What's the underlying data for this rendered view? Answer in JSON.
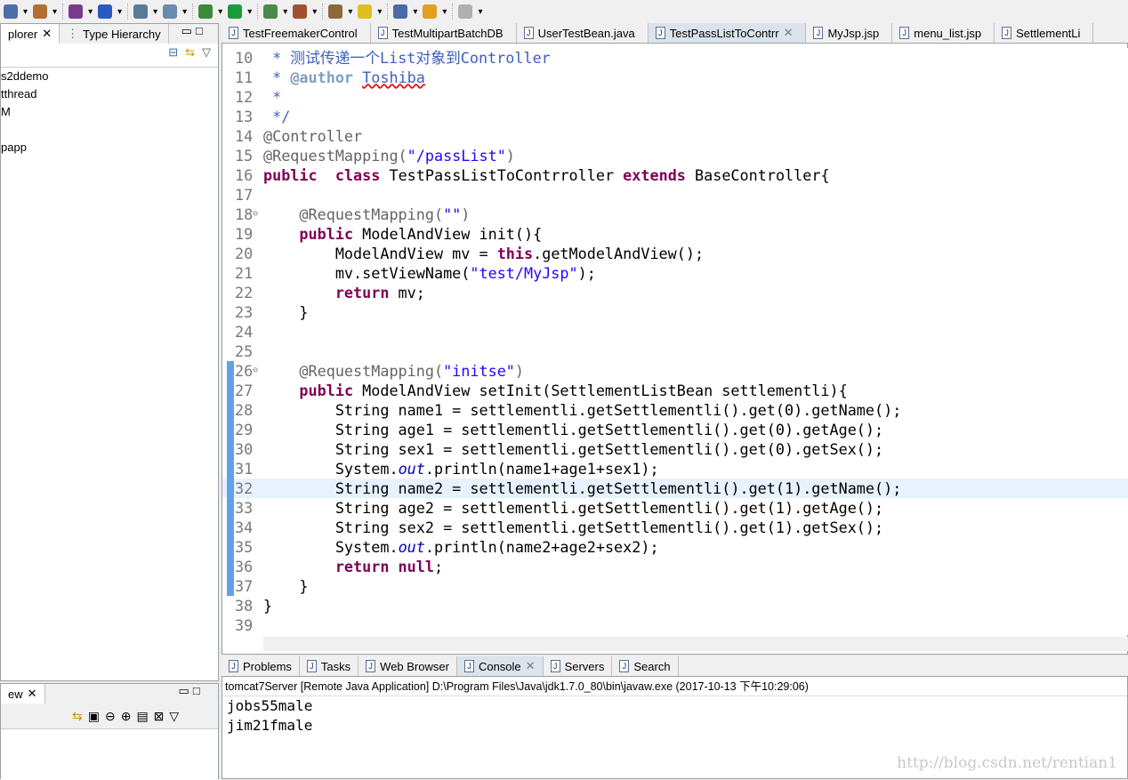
{
  "toolbar": {
    "icons": [
      "print-icon",
      "new-project-icon",
      "package-icon",
      "class-icon",
      "jdk-icon",
      "search-icon",
      "debug-icon",
      "run-icon",
      "coverage-icon",
      "tools-icon",
      "open-type-icon",
      "highlight-icon",
      "next-annotation-icon",
      "back-icon",
      "forward-icon"
    ]
  },
  "left_panel": {
    "tabs": [
      {
        "label": "plorer"
      },
      {
        "label": "Type Hierarchy"
      }
    ],
    "items": [
      "s2ddemo",
      "tthread",
      "M",
      "",
      "papp"
    ]
  },
  "left_bottom": {
    "tab": "ew"
  },
  "editor": {
    "tabs": [
      {
        "label": "TestFreemakerControl"
      },
      {
        "label": "TestMultipartBatchDB"
      },
      {
        "label": "UserTestBean.java"
      },
      {
        "label": "TestPassListToContrr",
        "active": true
      },
      {
        "label": "MyJsp.jsp"
      },
      {
        "label": "menu_list.jsp"
      },
      {
        "label": "SettlementLi"
      }
    ],
    "current_line": 32,
    "lines": [
      {
        "n": "10",
        "t": [
          [
            "cm",
            " * 测试传递一个List对象到Controller"
          ]
        ]
      },
      {
        "n": "11",
        "t": [
          [
            "cm",
            " * "
          ],
          [
            "tag",
            "@author"
          ],
          [
            "cm",
            " "
          ],
          [
            "auth",
            "Toshiba"
          ]
        ]
      },
      {
        "n": "12",
        "t": [
          [
            "cm",
            " *"
          ]
        ]
      },
      {
        "n": "13",
        "t": [
          [
            "cm",
            " */"
          ]
        ]
      },
      {
        "n": "14",
        "t": [
          [
            "an",
            "@Controller"
          ]
        ]
      },
      {
        "n": "15",
        "t": [
          [
            "an",
            "@RequestMapping("
          ],
          [
            "str",
            "\"/passList\""
          ],
          [
            "an",
            ")"
          ]
        ]
      },
      {
        "n": "16",
        "t": [
          [
            "kw",
            "public"
          ],
          [
            "",
            "  "
          ],
          [
            "kw",
            "class"
          ],
          [
            "",
            " TestPassListToContrroller "
          ],
          [
            "kw",
            "extends"
          ],
          [
            "",
            " BaseController{"
          ]
        ]
      },
      {
        "n": "17",
        "t": []
      },
      {
        "n": "18",
        "t": [
          [
            "an",
            "    @RequestMapping("
          ],
          [
            "str",
            "\"\""
          ],
          [
            "an",
            ")"
          ]
        ]
      },
      {
        "n": "19",
        "t": [
          [
            "",
            "    "
          ],
          [
            "kw",
            "public"
          ],
          [
            "",
            " ModelAndView init(){"
          ]
        ]
      },
      {
        "n": "20",
        "t": [
          [
            "",
            "        ModelAndView mv = "
          ],
          [
            "kw",
            "this"
          ],
          [
            "",
            ".getModelAndView();"
          ]
        ]
      },
      {
        "n": "21",
        "t": [
          [
            "",
            "        mv.setViewName("
          ],
          [
            "str",
            "\"test/MyJsp\""
          ],
          [
            "",
            ");"
          ]
        ]
      },
      {
        "n": "22",
        "t": [
          [
            "",
            "        "
          ],
          [
            "kw",
            "return"
          ],
          [
            "",
            " mv;"
          ]
        ]
      },
      {
        "n": "23",
        "t": [
          [
            "",
            "    }"
          ]
        ]
      },
      {
        "n": "24",
        "t": []
      },
      {
        "n": "25",
        "t": []
      },
      {
        "n": "26",
        "t": [
          [
            "an",
            "    @RequestMapping("
          ],
          [
            "str",
            "\"initse\""
          ],
          [
            "an",
            ")"
          ]
        ]
      },
      {
        "n": "27",
        "t": [
          [
            "",
            "    "
          ],
          [
            "kw",
            "public"
          ],
          [
            "",
            " ModelAndView setInit(SettlementListBean settlementli){"
          ]
        ]
      },
      {
        "n": "28",
        "t": [
          [
            "",
            "        String name1 = settlementli.getSettlementli().get(0).getName();"
          ]
        ]
      },
      {
        "n": "29",
        "t": [
          [
            "",
            "        String age1 = settlementli.getSettlementli().get(0).getAge();"
          ]
        ]
      },
      {
        "n": "30",
        "t": [
          [
            "",
            "        String sex1 = settlementli.getSettlementli().get(0).getSex();"
          ]
        ]
      },
      {
        "n": "31",
        "t": [
          [
            "",
            "        System."
          ],
          [
            "fld",
            "out"
          ],
          [
            "",
            ".println(name1+age1+sex1);"
          ]
        ]
      },
      {
        "n": "32",
        "t": [
          [
            "",
            "        String name2 = settlementli.getSettlementli().get(1).getName();"
          ]
        ]
      },
      {
        "n": "33",
        "t": [
          [
            "",
            "        String age2 = settlementli.getSettlementli().get(1).getAge();"
          ]
        ]
      },
      {
        "n": "34",
        "t": [
          [
            "",
            "        String sex2 = settlementli.getSettlementli().get(1).getSex();"
          ]
        ]
      },
      {
        "n": "35",
        "t": [
          [
            "",
            "        System."
          ],
          [
            "fld",
            "out"
          ],
          [
            "",
            ".println(name2+age2+sex2);"
          ]
        ]
      },
      {
        "n": "36",
        "t": [
          [
            "",
            "        "
          ],
          [
            "kw",
            "return"
          ],
          [
            "",
            ""
          ],
          [
            "kw",
            " null"
          ],
          [
            "",
            ";"
          ]
        ]
      },
      {
        "n": "37",
        "t": [
          [
            "",
            "    }"
          ]
        ]
      },
      {
        "n": "38",
        "t": [
          [
            "",
            "}"
          ]
        ]
      },
      {
        "n": "39",
        "t": []
      }
    ]
  },
  "bottom": {
    "tabs": [
      {
        "label": "Problems"
      },
      {
        "label": "Tasks"
      },
      {
        "label": "Web Browser"
      },
      {
        "label": "Console",
        "active": true
      },
      {
        "label": "Servers"
      },
      {
        "label": "Search"
      }
    ],
    "console_header": "tomcat7Server [Remote Java Application] D:\\Program Files\\Java\\jdk1.7.0_80\\bin\\javaw.exe (2017-10-13 下午10:29:06)",
    "output": [
      "jobs55male",
      "jim21fmale"
    ]
  },
  "watermark": "http://blog.csdn.net/rentian1"
}
